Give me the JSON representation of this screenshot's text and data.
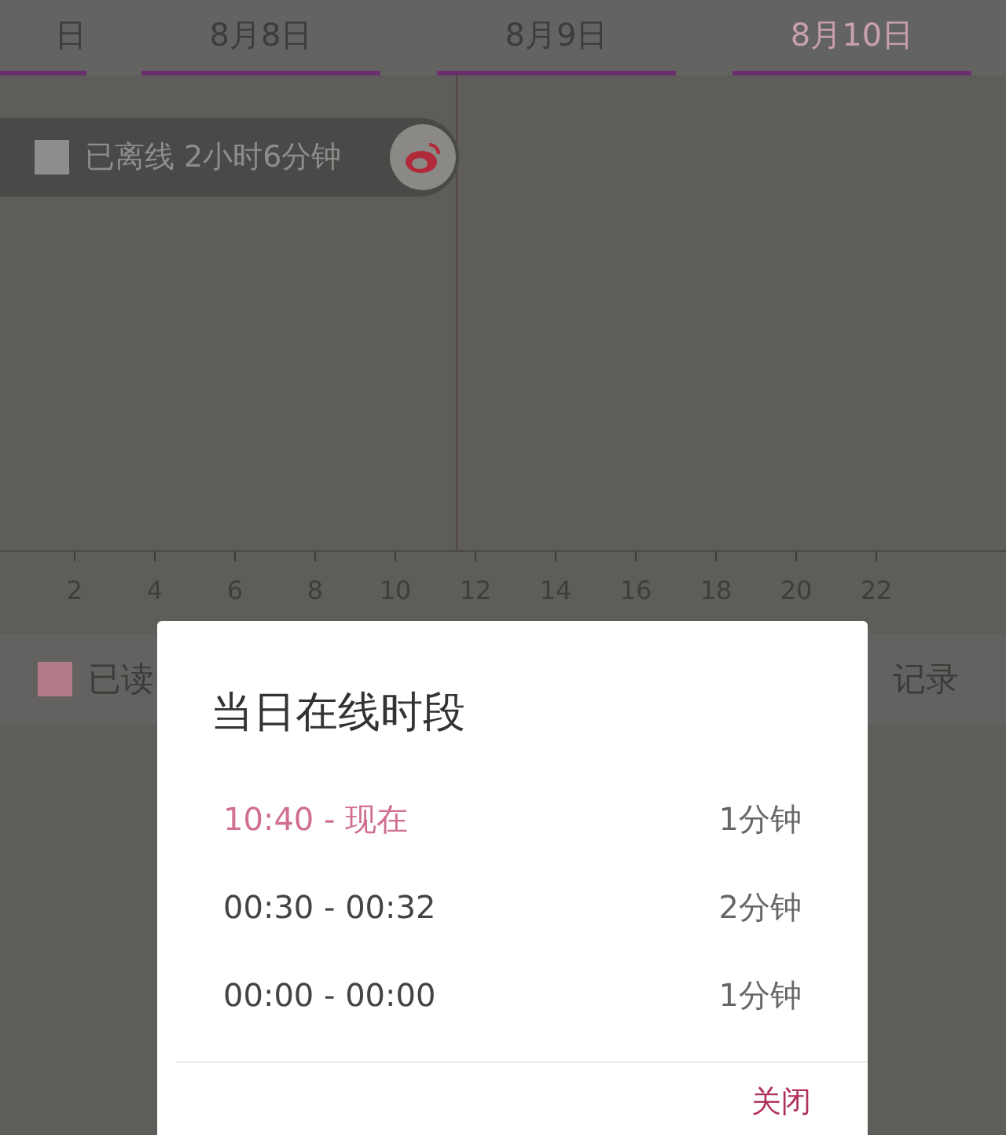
{
  "date_tabs": [
    {
      "label": "日",
      "selected": false
    },
    {
      "label": "8月8日",
      "selected": false
    },
    {
      "label": "8月9日",
      "selected": false
    },
    {
      "label": "8月10日",
      "selected": true
    }
  ],
  "status_tooltip": {
    "checked": false,
    "text": "已离线 2小时6分钟"
  },
  "axis_labels": [
    "2",
    "4",
    "6",
    "8",
    "10",
    "12",
    "14",
    "16",
    "18",
    "20",
    "22"
  ],
  "legend": [
    {
      "label": "已读",
      "color": "#b07a86"
    },
    {
      "label": "记录"
    }
  ],
  "dialog": {
    "title": "当日在线时段",
    "rows": [
      {
        "range": "10:40 - 现在",
        "duration": "1分钟",
        "current": true
      },
      {
        "range": "00:30 - 00:32",
        "duration": "2分钟",
        "current": false
      },
      {
        "range": "00:00 - 00:00",
        "duration": "1分钟",
        "current": false
      }
    ],
    "close_label": "关闭"
  }
}
